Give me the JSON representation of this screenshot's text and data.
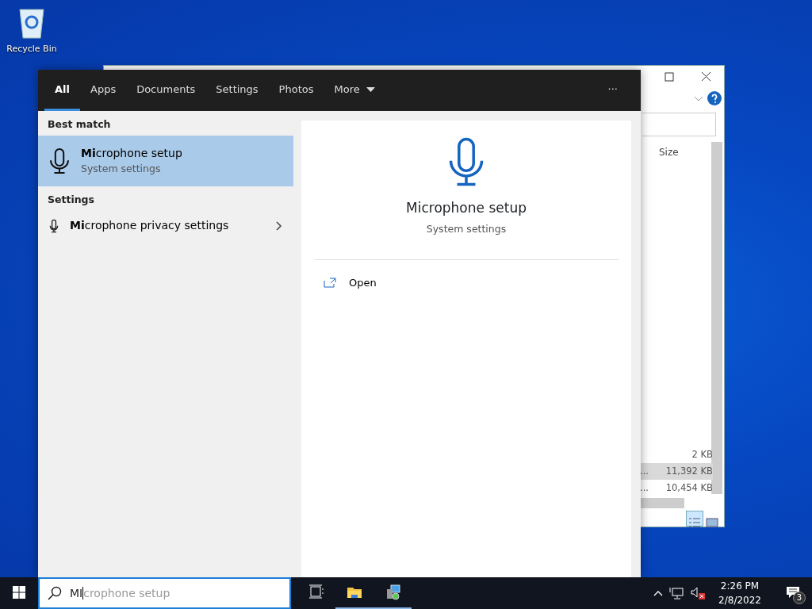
{
  "desktop_icons": [
    {
      "label": "Recycle Bin"
    }
  ],
  "explorer": {
    "column_header": "Size",
    "rows": [
      {
        "name": "",
        "size": "2 KB",
        "selected": false
      },
      {
        "name": "...",
        "size": "11,392 KB",
        "selected": true
      },
      {
        "name": "...",
        "size": "10,454 KB",
        "selected": false
      }
    ],
    "views": [
      {
        "kind": "details",
        "selected": true
      },
      {
        "kind": "preview",
        "selected": false
      }
    ]
  },
  "search_panel": {
    "tabs": [
      {
        "label": "All",
        "selected": true,
        "has_menu": false
      },
      {
        "label": "Apps",
        "selected": false,
        "has_menu": false
      },
      {
        "label": "Documents",
        "selected": false,
        "has_menu": false
      },
      {
        "label": "Settings",
        "selected": false,
        "has_menu": false
      },
      {
        "label": "Photos",
        "selected": false,
        "has_menu": false
      },
      {
        "label": "More",
        "selected": false,
        "has_menu": true
      }
    ],
    "options_button": "···",
    "sections": [
      {
        "heading": "Best match",
        "results": [
          {
            "kind": "large",
            "title": "**Mi**crophone setup",
            "subtitle": "System settings",
            "selected": true
          }
        ]
      },
      {
        "heading": "Settings",
        "results": [
          {
            "kind": "small",
            "title": "**Mi**crophone privacy settings",
            "selected": false
          }
        ]
      }
    ],
    "preview": {
      "title": "Microphone setup",
      "subtitle": "System settings",
      "actions": [
        {
          "label": "Open"
        }
      ]
    }
  },
  "taskbar": {
    "search": {
      "value": "MI",
      "suggestion": "crophone setup"
    },
    "apps": [
      {
        "kind": "task-view",
        "running": false
      },
      {
        "kind": "folder",
        "running": true
      },
      {
        "kind": "installer",
        "running": true
      }
    ],
    "clock": {
      "time": "2:26 PM",
      "date": "2/8/2022"
    },
    "notification_count": "3"
  }
}
